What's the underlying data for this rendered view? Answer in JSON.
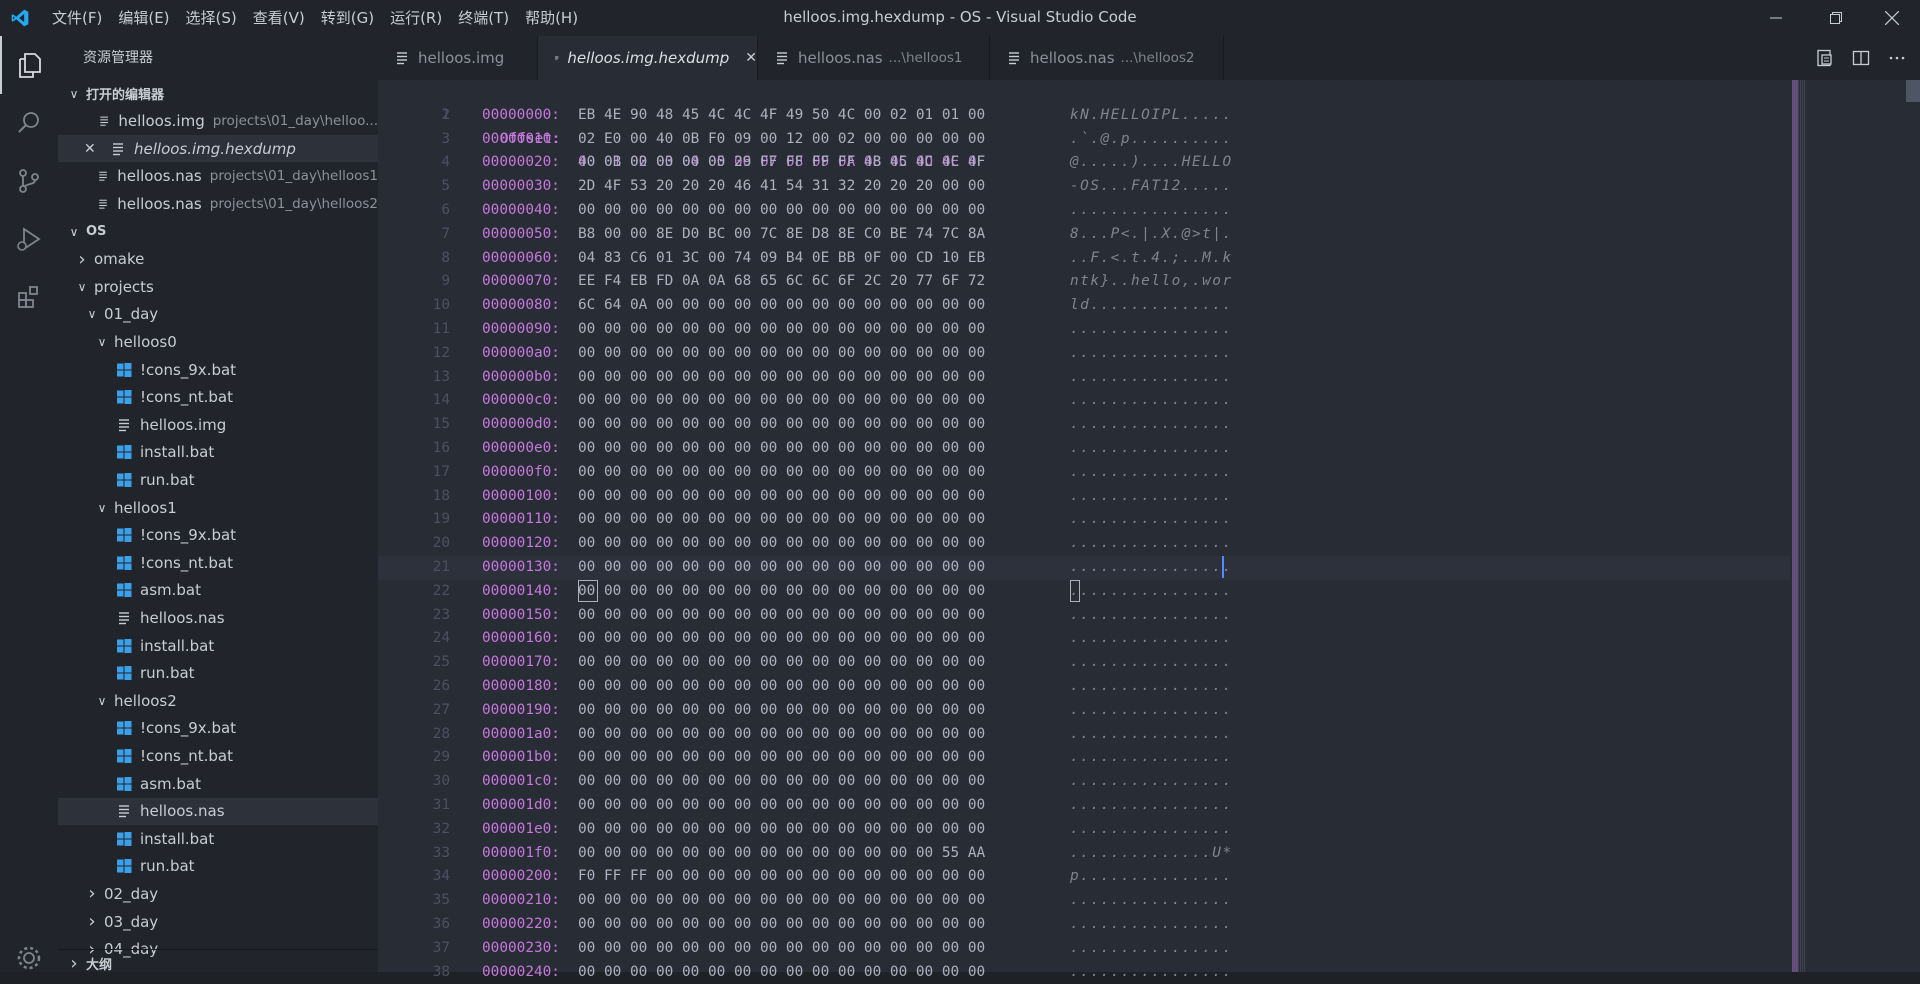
{
  "window": {
    "title": "helloos.img.hexdump - OS - Visual Studio Code"
  },
  "colors": {
    "accent": "#528bff",
    "offset_purple": "#c678dd",
    "vscode_blue": "#23a9f2",
    "windows_blue": "#3aa0e8"
  },
  "menu": [
    "文件(F)",
    "编辑(E)",
    "选择(S)",
    "查看(V)",
    "转到(G)",
    "运行(R)",
    "终端(T)",
    "帮助(H)"
  ],
  "sidebar": {
    "title": "资源管理器",
    "open_editors_label": "打开的编辑器",
    "open_editors": [
      {
        "name": "helloos.img",
        "desc": "projects\\01_day\\helloo..."
      },
      {
        "name": "helloos.img.hexdump",
        "desc": ""
      },
      {
        "name": "helloos.nas",
        "desc": "projects\\01_day\\helloos1"
      },
      {
        "name": "helloos.nas",
        "desc": "projects\\01_day\\helloos2"
      }
    ],
    "workspace_label": "OS",
    "tree": [
      {
        "label": "omake",
        "depth": 0,
        "type": "folder",
        "state": "collapsed"
      },
      {
        "label": "projects",
        "depth": 0,
        "type": "folder",
        "state": "expanded"
      },
      {
        "label": "01_day",
        "depth": 1,
        "type": "folder",
        "state": "expanded"
      },
      {
        "label": "helloos0",
        "depth": 2,
        "type": "folder",
        "state": "expanded"
      },
      {
        "label": "!cons_9x.bat",
        "depth": 3,
        "type": "bat"
      },
      {
        "label": "!cons_nt.bat",
        "depth": 3,
        "type": "bat"
      },
      {
        "label": "helloos.img",
        "depth": 3,
        "type": "file"
      },
      {
        "label": "install.bat",
        "depth": 3,
        "type": "bat"
      },
      {
        "label": "run.bat",
        "depth": 3,
        "type": "bat"
      },
      {
        "label": "helloos1",
        "depth": 2,
        "type": "folder",
        "state": "expanded"
      },
      {
        "label": "!cons_9x.bat",
        "depth": 3,
        "type": "bat"
      },
      {
        "label": "!cons_nt.bat",
        "depth": 3,
        "type": "bat"
      },
      {
        "label": "asm.bat",
        "depth": 3,
        "type": "bat"
      },
      {
        "label": "helloos.nas",
        "depth": 3,
        "type": "file"
      },
      {
        "label": "install.bat",
        "depth": 3,
        "type": "bat"
      },
      {
        "label": "run.bat",
        "depth": 3,
        "type": "bat"
      },
      {
        "label": "helloos2",
        "depth": 2,
        "type": "folder",
        "state": "expanded"
      },
      {
        "label": "!cons_9x.bat",
        "depth": 3,
        "type": "bat"
      },
      {
        "label": "!cons_nt.bat",
        "depth": 3,
        "type": "bat"
      },
      {
        "label": "asm.bat",
        "depth": 3,
        "type": "bat"
      },
      {
        "label": "helloos.nas",
        "depth": 3,
        "type": "file",
        "selected": true
      },
      {
        "label": "install.bat",
        "depth": 3,
        "type": "bat"
      },
      {
        "label": "run.bat",
        "depth": 3,
        "type": "bat"
      },
      {
        "label": "02_day",
        "depth": 1,
        "type": "folder",
        "state": "collapsed"
      },
      {
        "label": "03_day",
        "depth": 1,
        "type": "folder",
        "state": "collapsed"
      },
      {
        "label": "04_day",
        "depth": 1,
        "type": "folder",
        "state": "collapsed"
      }
    ],
    "outline_label": "大纲"
  },
  "tabs": [
    {
      "name": "helloos.img",
      "desc": ""
    },
    {
      "name": "helloos.img.hexdump",
      "desc": "",
      "active": true
    },
    {
      "name": "helloos.nas",
      "desc": "...\\helloos1"
    },
    {
      "name": "helloos.nas",
      "desc": "...\\helloos2"
    }
  ],
  "hexdump": {
    "header_label": "Offset:",
    "header_cols": "00 01 02 03 04 05 06 07 08 09 0A 0B 0C 0D 0E 0F",
    "rows": [
      {
        "n": "2",
        "off": "00000000:",
        "hex": "EB 4E 90 48 45 4C 4C 4F 49 50 4C 00 02 01 01 00",
        "ascii": "kN.HELLOIPL....."
      },
      {
        "n": "3",
        "off": "00000010:",
        "hex": "02 E0 00 40 0B F0 09 00 12 00 02 00 00 00 00 00",
        "ascii": ".`.@.p.........."
      },
      {
        "n": "4",
        "off": "00000020:",
        "hex": "40 0B 00 00 00 00 29 FF FF FF FF 48 45 4C 4C 4F",
        "ascii": "@.....)....HELLO"
      },
      {
        "n": "5",
        "off": "00000030:",
        "hex": "2D 4F 53 20 20 20 46 41 54 31 32 20 20 20 00 00",
        "ascii": "-OS...FAT12....."
      },
      {
        "n": "6",
        "off": "00000040:",
        "hex": "00 00 00 00 00 00 00 00 00 00 00 00 00 00 00 00",
        "ascii": "................"
      },
      {
        "n": "7",
        "off": "00000050:",
        "hex": "B8 00 00 8E D0 BC 00 7C 8E D8 8E C0 BE 74 7C 8A",
        "ascii": "8...P<.|.X.@>t|."
      },
      {
        "n": "8",
        "off": "00000060:",
        "hex": "04 83 C6 01 3C 00 74 09 B4 0E BB 0F 00 CD 10 EB",
        "ascii": "..F.<.t.4.;..M.k"
      },
      {
        "n": "9",
        "off": "00000070:",
        "hex": "EE F4 EB FD 0A 0A 68 65 6C 6C 6F 2C 20 77 6F 72",
        "ascii": "ntk}..hello,.wor"
      },
      {
        "n": "10",
        "off": "00000080:",
        "hex": "6C 64 0A 00 00 00 00 00 00 00 00 00 00 00 00 00",
        "ascii": "ld.............."
      },
      {
        "n": "11",
        "off": "00000090:",
        "hex": "00 00 00 00 00 00 00 00 00 00 00 00 00 00 00 00",
        "ascii": "................"
      },
      {
        "n": "12",
        "off": "000000a0:",
        "hex": "00 00 00 00 00 00 00 00 00 00 00 00 00 00 00 00",
        "ascii": "................"
      },
      {
        "n": "13",
        "off": "000000b0:",
        "hex": "00 00 00 00 00 00 00 00 00 00 00 00 00 00 00 00",
        "ascii": "................"
      },
      {
        "n": "14",
        "off": "000000c0:",
        "hex": "00 00 00 00 00 00 00 00 00 00 00 00 00 00 00 00",
        "ascii": "................"
      },
      {
        "n": "15",
        "off": "000000d0:",
        "hex": "00 00 00 00 00 00 00 00 00 00 00 00 00 00 00 00",
        "ascii": "................"
      },
      {
        "n": "16",
        "off": "000000e0:",
        "hex": "00 00 00 00 00 00 00 00 00 00 00 00 00 00 00 00",
        "ascii": "................"
      },
      {
        "n": "17",
        "off": "000000f0:",
        "hex": "00 00 00 00 00 00 00 00 00 00 00 00 00 00 00 00",
        "ascii": "................"
      },
      {
        "n": "18",
        "off": "00000100:",
        "hex": "00 00 00 00 00 00 00 00 00 00 00 00 00 00 00 00",
        "ascii": "................"
      },
      {
        "n": "19",
        "off": "00000110:",
        "hex": "00 00 00 00 00 00 00 00 00 00 00 00 00 00 00 00",
        "ascii": "................"
      },
      {
        "n": "20",
        "off": "00000120:",
        "hex": "00 00 00 00 00 00 00 00 00 00 00 00 00 00 00 00",
        "ascii": "................"
      },
      {
        "n": "21",
        "off": "00000130:",
        "hex": "00 00 00 00 00 00 00 00 00 00 00 00 00 00 00 00",
        "ascii": "................"
      },
      {
        "n": "22",
        "off": "00000140:",
        "hex": "00 00 00 00 00 00 00 00 00 00 00 00 00 00 00 00",
        "ascii": "................"
      },
      {
        "n": "23",
        "off": "00000150:",
        "hex": "00 00 00 00 00 00 00 00 00 00 00 00 00 00 00 00",
        "ascii": "................"
      },
      {
        "n": "24",
        "off": "00000160:",
        "hex": "00 00 00 00 00 00 00 00 00 00 00 00 00 00 00 00",
        "ascii": "................"
      },
      {
        "n": "25",
        "off": "00000170:",
        "hex": "00 00 00 00 00 00 00 00 00 00 00 00 00 00 00 00",
        "ascii": "................"
      },
      {
        "n": "26",
        "off": "00000180:",
        "hex": "00 00 00 00 00 00 00 00 00 00 00 00 00 00 00 00",
        "ascii": "................"
      },
      {
        "n": "27",
        "off": "00000190:",
        "hex": "00 00 00 00 00 00 00 00 00 00 00 00 00 00 00 00",
        "ascii": "................"
      },
      {
        "n": "28",
        "off": "000001a0:",
        "hex": "00 00 00 00 00 00 00 00 00 00 00 00 00 00 00 00",
        "ascii": "................"
      },
      {
        "n": "29",
        "off": "000001b0:",
        "hex": "00 00 00 00 00 00 00 00 00 00 00 00 00 00 00 00",
        "ascii": "................"
      },
      {
        "n": "30",
        "off": "000001c0:",
        "hex": "00 00 00 00 00 00 00 00 00 00 00 00 00 00 00 00",
        "ascii": "................"
      },
      {
        "n": "31",
        "off": "000001d0:",
        "hex": "00 00 00 00 00 00 00 00 00 00 00 00 00 00 00 00",
        "ascii": "................"
      },
      {
        "n": "32",
        "off": "000001e0:",
        "hex": "00 00 00 00 00 00 00 00 00 00 00 00 00 00 00 00",
        "ascii": "................"
      },
      {
        "n": "33",
        "off": "000001f0:",
        "hex": "00 00 00 00 00 00 00 00 00 00 00 00 00 00 55 AA",
        "ascii": "..............U*"
      },
      {
        "n": "34",
        "off": "00000200:",
        "hex": "F0 FF FF 00 00 00 00 00 00 00 00 00 00 00 00 00",
        "ascii": "p..............."
      },
      {
        "n": "35",
        "off": "00000210:",
        "hex": "00 00 00 00 00 00 00 00 00 00 00 00 00 00 00 00",
        "ascii": "................"
      },
      {
        "n": "36",
        "off": "00000220:",
        "hex": "00 00 00 00 00 00 00 00 00 00 00 00 00 00 00 00",
        "ascii": "................"
      },
      {
        "n": "37",
        "off": "00000230:",
        "hex": "00 00 00 00 00 00 00 00 00 00 00 00 00 00 00 00",
        "ascii": "................"
      },
      {
        "n": "38",
        "off": "00000240:",
        "hex": "00 00 00 00 00 00 00 00 00 00 00 00 00 00 00 00",
        "ascii": "................"
      }
    ]
  }
}
